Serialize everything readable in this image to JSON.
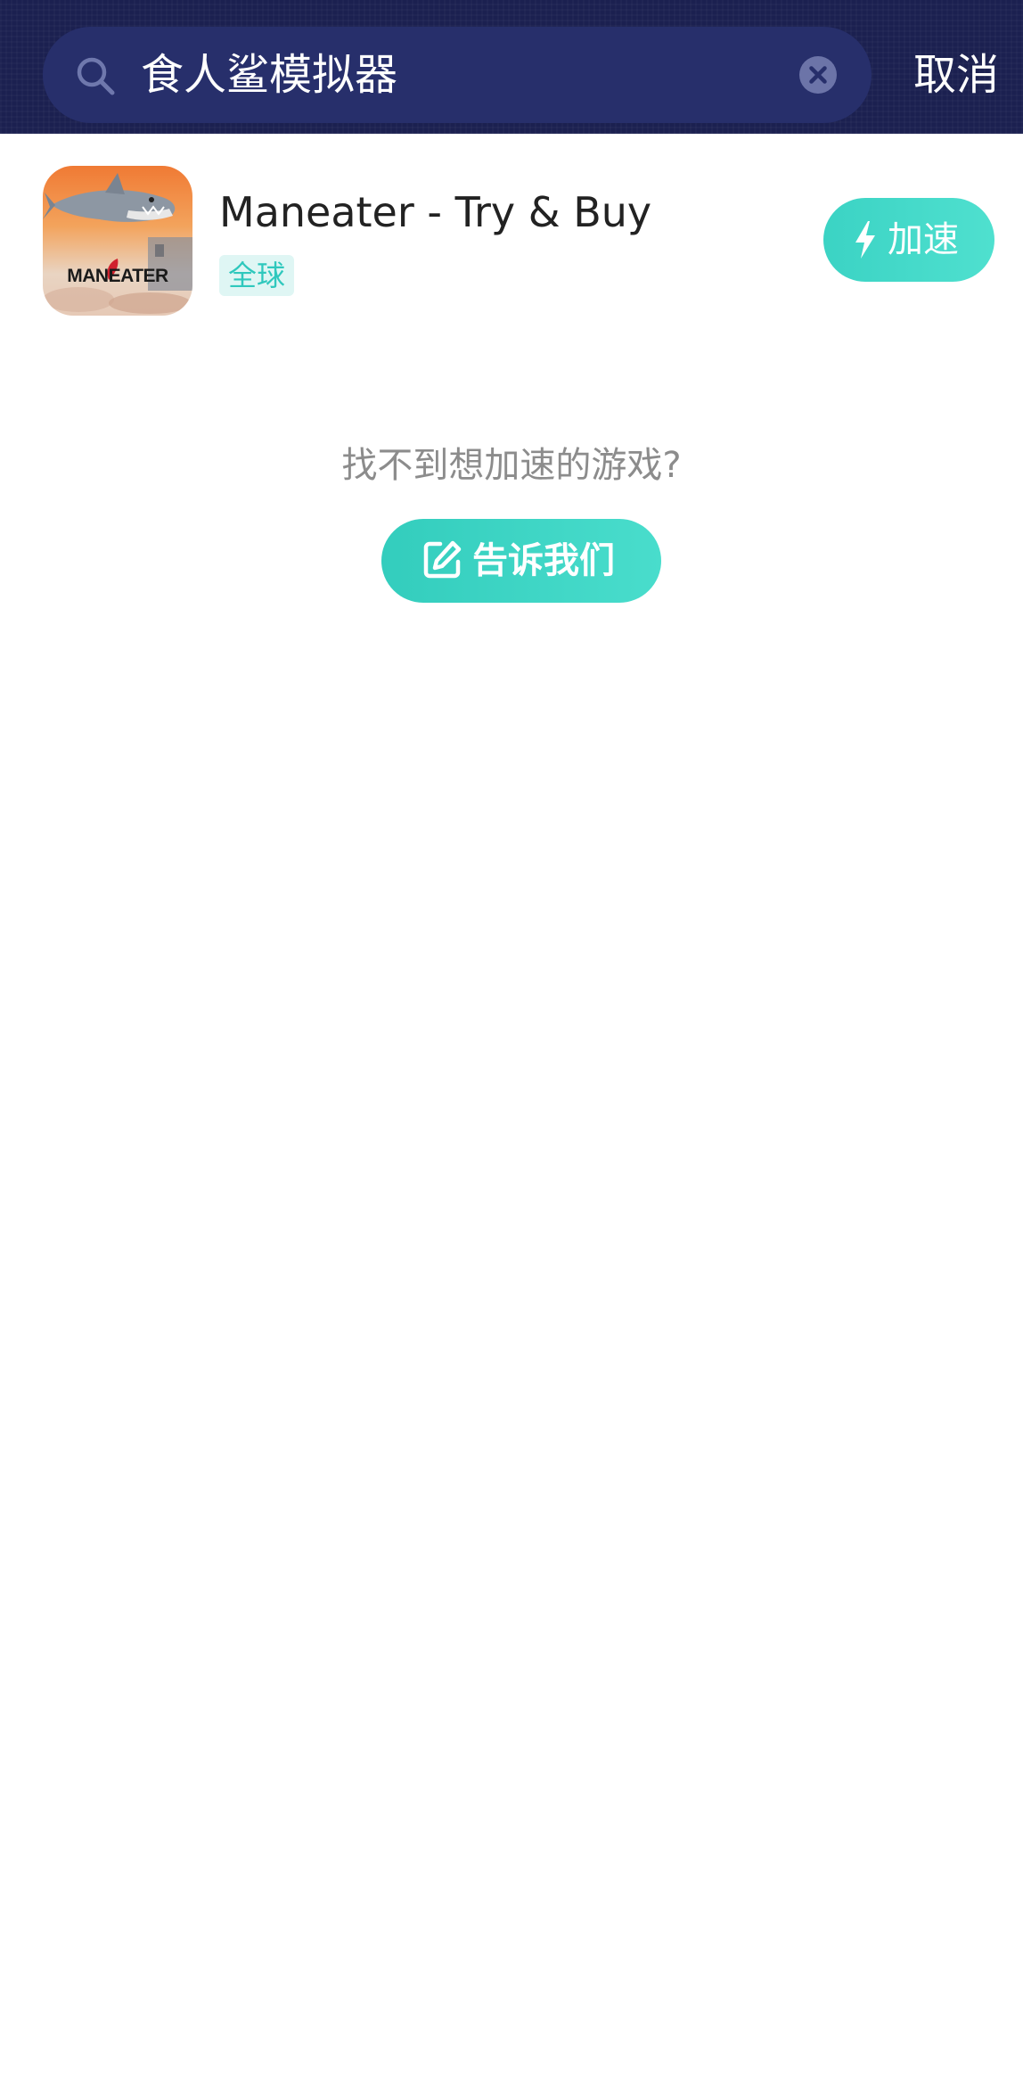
{
  "search": {
    "query": "食人鲨模拟器",
    "cancel_label": "取消"
  },
  "results": [
    {
      "name": "Maneater - Try & Buy",
      "region": "全球",
      "action_label": "加速",
      "icon_text": "MANEATER"
    }
  ],
  "empty_prompt": {
    "text": "找不到想加速的游戏?",
    "button_label": "告诉我们"
  },
  "colors": {
    "header_bg": "#1b2050",
    "search_bg": "#272f6b",
    "accent": "#3bd3c4",
    "region_badge_bg": "#dff6f4",
    "region_badge_text": "#2fc8bd",
    "prompt_text": "#8c8c8c"
  },
  "icons": [
    "search-icon",
    "clear-icon",
    "bolt-icon",
    "edit-icon"
  ]
}
